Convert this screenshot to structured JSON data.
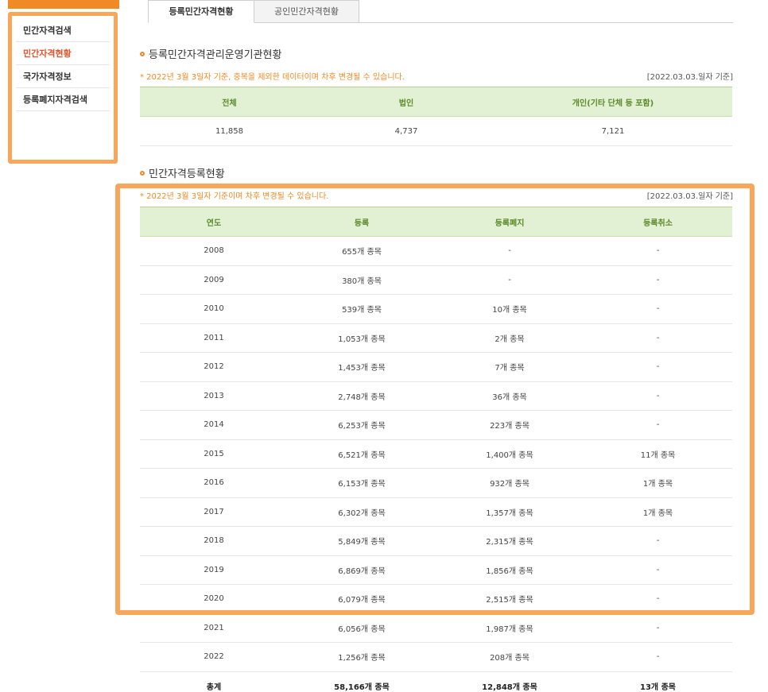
{
  "sidebar": {
    "items": [
      {
        "label": "민간자격검색",
        "active": false
      },
      {
        "label": "민간자격현황",
        "active": true
      },
      {
        "label": "국가자격정보",
        "active": false
      },
      {
        "label": "등록폐지자격검색",
        "active": false
      }
    ]
  },
  "tabs": [
    {
      "label": "등록민간자격현황",
      "active": true
    },
    {
      "label": "공인민간자격현황",
      "active": false
    }
  ],
  "section1": {
    "title": "등록민간자격관리운영기관현황",
    "note": "* 2022년 3월 3일자 기준, 중복을 제외한 데이터이며 차후 변경될 수 있습니다.",
    "basis": "[2022.03.03.일자 기준]",
    "headers": [
      "전체",
      "법인",
      "개인(기타 단체 등 포함)"
    ],
    "values": [
      "11,858",
      "4,737",
      "7,121"
    ]
  },
  "section2": {
    "title": "민간자격등록현황",
    "note": "* 2022년 3월 3일자 기준이며 차후 변경될 수 있습니다.",
    "basis": "[2022.03.03.일자 기준]",
    "headers": [
      "연도",
      "등록",
      "등록폐지",
      "등록취소"
    ],
    "rows": [
      [
        "2008",
        "655개 종목",
        "-",
        "-"
      ],
      [
        "2009",
        "380개 종목",
        "-",
        "-"
      ],
      [
        "2010",
        "539개 종목",
        "10개 종목",
        "-"
      ],
      [
        "2011",
        "1,053개 종목",
        "2개 종목",
        "-"
      ],
      [
        "2012",
        "1,453개 종목",
        "7개 종목",
        "-"
      ],
      [
        "2013",
        "2,748개 종목",
        "36개 종목",
        "-"
      ],
      [
        "2014",
        "6,253개 종목",
        "223개 종목",
        "-"
      ],
      [
        "2015",
        "6,521개 종목",
        "1,400개 종목",
        "11개 종목"
      ],
      [
        "2016",
        "6,153개 종목",
        "932개 종목",
        "1개 종목"
      ],
      [
        "2017",
        "6,302개 종목",
        "1,357개 종목",
        "1개 종목"
      ],
      [
        "2018",
        "5,849개 종목",
        "2,315개 종목",
        "-"
      ],
      [
        "2019",
        "6,869개 종목",
        "1,856개 종목",
        "-"
      ],
      [
        "2020",
        "6,079개 종목",
        "2,515개 종목",
        "-"
      ],
      [
        "2021",
        "6,056개 종목",
        "1,987개 종목",
        "-"
      ],
      [
        "2022",
        "1,256개 종목",
        "208개 종목",
        "-"
      ]
    ],
    "total": [
      "총계",
      "58,166개 종목",
      "12,848개 종목",
      "13개 종목"
    ]
  },
  "colors": {
    "accent_orange": "#f08a24",
    "highlight_orange": "#f9a65b",
    "active_red": "#e8512a",
    "header_green_bg": "#e2f0d3",
    "header_green_text": "#5b8a2a"
  }
}
